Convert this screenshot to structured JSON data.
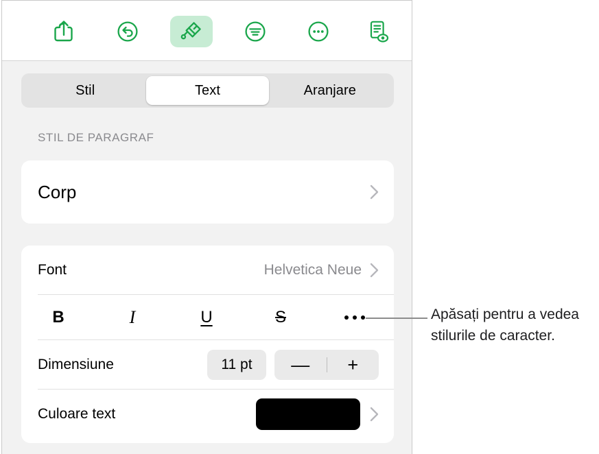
{
  "toolbar": {
    "buttons": [
      {
        "name": "share-icon",
        "label": "Partajare"
      },
      {
        "name": "undo-icon",
        "label": "Anulare"
      },
      {
        "name": "paintbrush-icon",
        "label": "Format",
        "active": true
      },
      {
        "name": "insert-icon",
        "label": "Inserare"
      },
      {
        "name": "more-icon",
        "label": "Mai multe"
      },
      {
        "name": "document-view-icon",
        "label": "Vizualizare document"
      }
    ]
  },
  "tabs": [
    {
      "label": "Stil",
      "selected": false
    },
    {
      "label": "Text",
      "selected": true
    },
    {
      "label": "Aranjare",
      "selected": false
    }
  ],
  "section": {
    "paragraph_style_header": "STIL DE PARAGRAF",
    "paragraph_style_value": "Corp"
  },
  "rows": {
    "font_label": "Font",
    "font_value": "Helvetica Neue",
    "size_label": "Dimensiune",
    "size_value": "11 pt",
    "minus_label": "—",
    "plus_label": "+",
    "color_label": "Culoare text"
  },
  "style_buttons": [
    {
      "name": "bold-button",
      "label": "B"
    },
    {
      "name": "italic-button",
      "label": "I"
    },
    {
      "name": "underline-button",
      "label": "U"
    },
    {
      "name": "strikethrough-button",
      "label": "S"
    },
    {
      "name": "more-text-styles-button",
      "label": "•••"
    }
  ],
  "callout": {
    "text": "Apăsați pentru a vedea stilurile de caracter."
  },
  "colors": {
    "accent_green": "#1aa64b",
    "accent_green_bg": "#c7ecd4",
    "panel_bg": "#f2f2f2",
    "card_bg": "#ffffff",
    "text_color_swatch": "#000000",
    "muted_text": "#8a8a8e"
  }
}
